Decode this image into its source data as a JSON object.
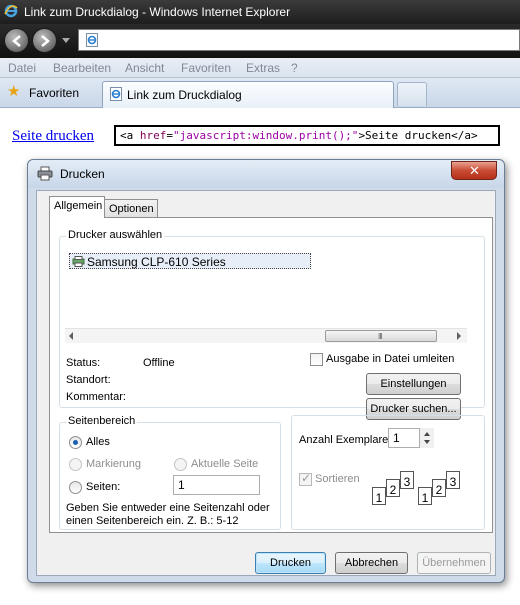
{
  "browser": {
    "window_title": "Link zum Druckdialog - Windows Internet Explorer",
    "menu": [
      "Datei",
      "Bearbeiten",
      "Ansicht",
      "Favoriten",
      "Extras",
      "?"
    ],
    "favorites_label": "Favoriten",
    "tab_title": "Link zum Druckdialog"
  },
  "page": {
    "link_text": "Seite drucken",
    "code": {
      "open": "<a ",
      "attr": "href",
      "eq": "=",
      "value": "\"javascript:window.print();\"",
      "rest": ">Seite drucken</a>"
    }
  },
  "dialog": {
    "title": "Drucken",
    "close_symbol": "✕",
    "tabs": [
      "Allgemein",
      "Optionen"
    ],
    "printer_group": {
      "legend": "Drucker auswählen",
      "printers": [
        "Samsung CLP-610 Series"
      ],
      "scroll_grip": "III",
      "status_label": "Status:",
      "status_value": "Offline",
      "location_label": "Standort:",
      "comment_label": "Kommentar:",
      "print_to_file_label": "Ausgabe in Datei umleiten",
      "preferences_button": "Einstellungen",
      "find_printer_button": "Drucker suchen..."
    },
    "page_range": {
      "legend": "Seitenbereich",
      "all_label": "Alles",
      "selection_label": "Markierung",
      "current_page_label": "Aktuelle Seite",
      "pages_label": "Seiten:",
      "pages_value": "1",
      "hint": "Geben Sie entweder eine Seitenzahl oder einen Seitenbereich ein. Z. B.: 5-12"
    },
    "copies": {
      "label": "Anzahl Exemplare:",
      "value": "1",
      "collate_label": "Sortieren",
      "collate_sheets": [
        "1",
        "2",
        "3"
      ]
    },
    "buttons": {
      "print": "Drucken",
      "cancel": "Abbrechen",
      "apply": "Übernehmen"
    }
  }
}
